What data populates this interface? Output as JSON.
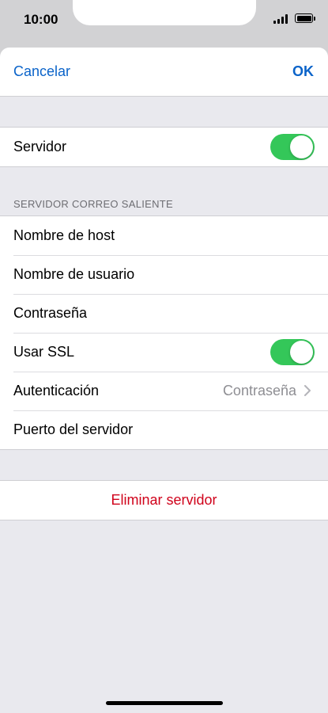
{
  "status": {
    "time": "10:00"
  },
  "nav": {
    "cancel_label": "Cancelar",
    "ok_label": "OK"
  },
  "server_row": {
    "label": "Servidor",
    "toggle_on": true
  },
  "outgoing": {
    "header": "SERVIDOR CORREO SALIENTE",
    "host_label": "Nombre de host",
    "user_label": "Nombre de usuario",
    "password_label": "Contraseña",
    "ssl_label": "Usar SSL",
    "ssl_on": true,
    "auth_label": "Autenticación",
    "auth_value": "Contraseña",
    "port_label": "Puerto del servidor"
  },
  "delete_label": "Eliminar servidor",
  "colors": {
    "accent": "#0a63c9",
    "toggle_on": "#34c759",
    "destructive": "#d0021b"
  }
}
